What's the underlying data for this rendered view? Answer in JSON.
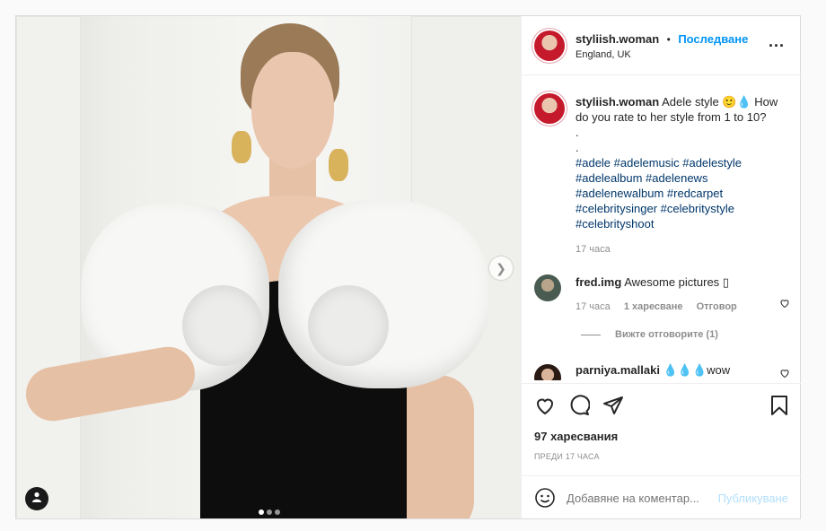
{
  "header": {
    "username": "styliish.woman",
    "separator": "•",
    "follow_label": "Последване",
    "location": "England, UK",
    "more_label": "..."
  },
  "caption": {
    "username": "styliish.woman",
    "text": "Adele style 🙂💧 How do you rate to her style from 1 to 10?",
    "dot1": ".",
    "dot2": ".",
    "hashtags_line1": "#adele #adelemusic #adelestyle",
    "hashtags_line2": "#adelealbum #adelenews",
    "hashtags_line3": "#adelenewalbum #redcarpet",
    "hashtags_line4": "#celebritysinger #celebritystyle",
    "hashtags_line5": "#celebrityshoot",
    "time": "17 часа"
  },
  "comments": [
    {
      "username": "fred.img",
      "text": "Awesome pictures ▯",
      "time": "17 часа",
      "likes": "1 харесване",
      "reply": "Отговор",
      "view_replies": "Вижте отговорите (1)"
    },
    {
      "username": "parniya.mallaki",
      "text": "💧💧💧wow"
    }
  ],
  "stats": {
    "likes": "97 харесвания",
    "posted": "ПРЕДИ 17 ЧАСА"
  },
  "add_comment": {
    "placeholder": "Добавяне на коментар...",
    "publish_label": "Публикуване"
  },
  "carousel": {
    "current": 1,
    "total": 3
  },
  "colors": {
    "accent": "#0095f6",
    "hashtag": "#00376b",
    "muted": "#8e8e8e",
    "border": "#dbdbdb"
  },
  "icons": {
    "like": "heart-icon",
    "comment": "comment-icon",
    "share": "send-icon",
    "save": "bookmark-icon",
    "emoji": "emoji-icon",
    "next": "chevron-right-icon",
    "tagged_user": "user-icon"
  }
}
